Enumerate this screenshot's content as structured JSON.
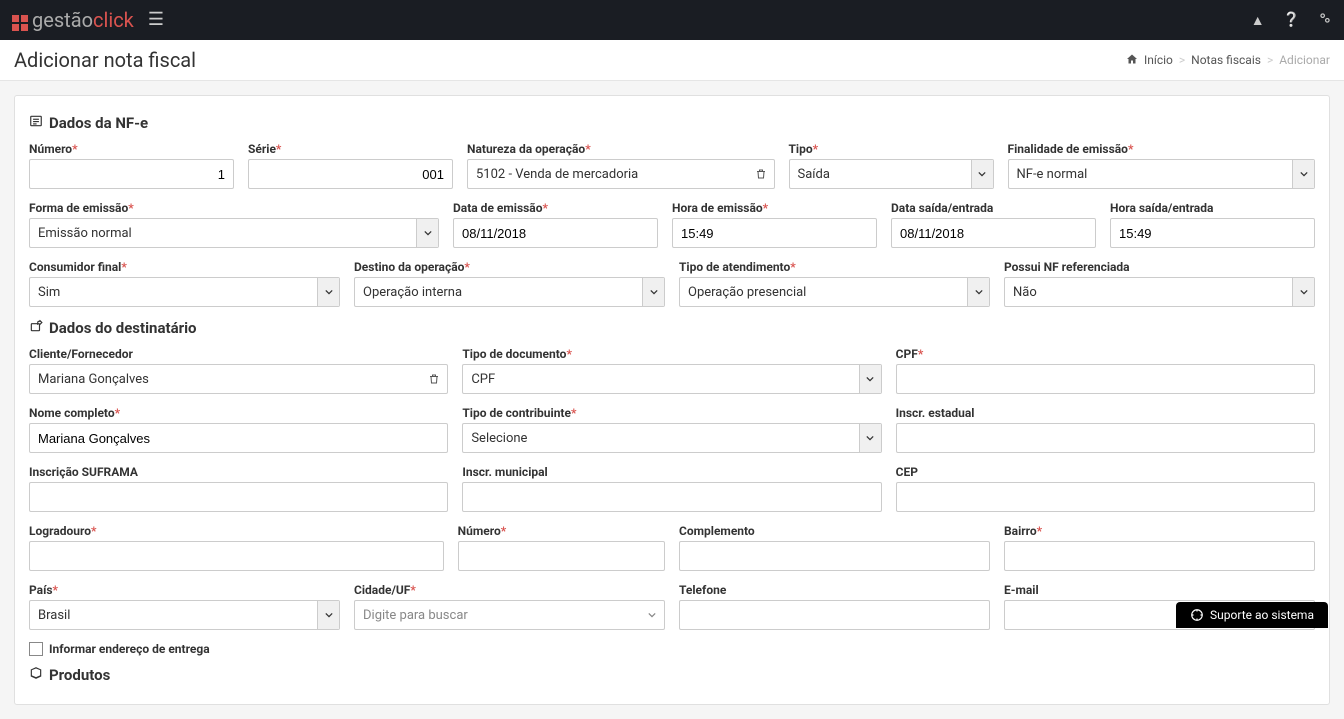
{
  "logo": {
    "part1": "gestão",
    "part2": "click"
  },
  "page": {
    "title": "Adicionar nota fiscal"
  },
  "breadcrumb": {
    "home": "Início",
    "mid": "Notas fiscais",
    "current": "Adicionar"
  },
  "sections": {
    "nfe": "Dados da NF-e",
    "dest": "Dados do destinatário",
    "prod": "Produtos"
  },
  "labels": {
    "numero": "Número",
    "serie": "Série",
    "natureza": "Natureza da operação",
    "tipo": "Tipo",
    "finalidade": "Finalidade de emissão",
    "forma_emissao": "Forma de emissão",
    "data_emissao": "Data de emissão",
    "hora_emissao": "Hora de emissão",
    "data_saida": "Data saída/entrada",
    "hora_saida": "Hora saída/entrada",
    "consumidor_final": "Consumidor final",
    "destino_operacao": "Destino da operação",
    "tipo_atendimento": "Tipo de atendimento",
    "possui_nf_ref": "Possui NF referenciada",
    "cliente_fornecedor": "Cliente/Fornecedor",
    "tipo_documento": "Tipo de documento",
    "cpf": "CPF",
    "nome_completo": "Nome completo",
    "tipo_contribuinte": "Tipo de contribuinte",
    "inscr_estadual": "Inscr. estadual",
    "inscricao_suframa": "Inscrição SUFRAMA",
    "inscr_municipal": "Inscr. municipal",
    "cep": "CEP",
    "logradouro": "Logradouro",
    "numero_addr": "Número",
    "complemento": "Complemento",
    "bairro": "Bairro",
    "pais": "País",
    "cidade_uf": "Cidade/UF",
    "telefone": "Telefone",
    "email": "E-mail",
    "informar_endereco": "Informar endereço de entrega"
  },
  "values": {
    "numero": "1",
    "serie": "001",
    "natureza": "5102 - Venda de mercadoria",
    "tipo": "Saída",
    "finalidade": "NF-e normal",
    "forma_emissao": "Emissão normal",
    "data_emissao": "08/11/2018",
    "hora_emissao": "15:49",
    "data_saida": "08/11/2018",
    "hora_saida": "15:49",
    "consumidor_final": "Sim",
    "destino_operacao": "Operação interna",
    "tipo_atendimento": "Operação presencial",
    "possui_nf_ref": "Não",
    "cliente_fornecedor": "Mariana Gonçalves",
    "tipo_documento": "CPF",
    "nome_completo": "Mariana Gonçalves",
    "tipo_contribuinte": "Selecione",
    "pais": "Brasil",
    "cidade_uf_placeholder": "Digite para buscar"
  },
  "support": "Suporte ao sistema"
}
